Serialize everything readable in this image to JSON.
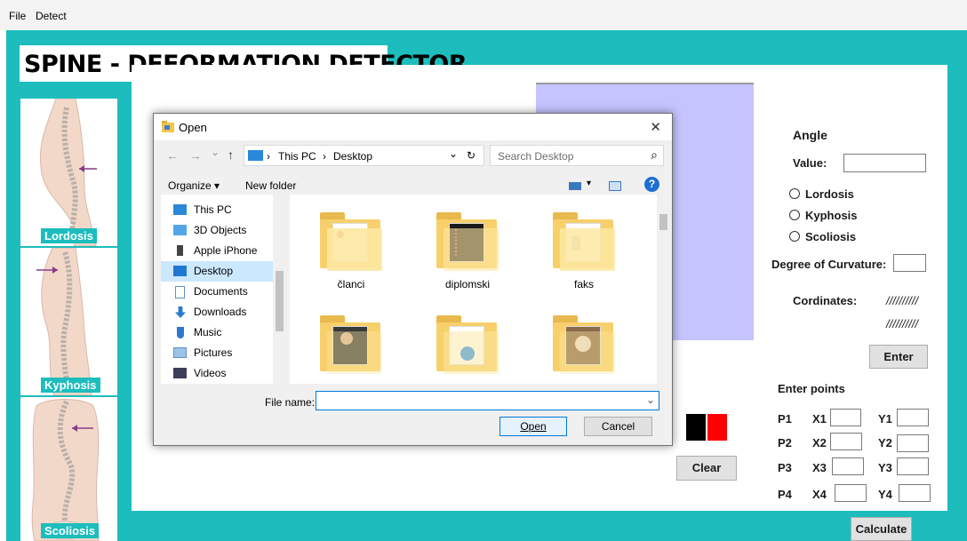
{
  "menu": {
    "file": "File",
    "detect": "Detect"
  },
  "app": {
    "title": "SPINE - DEFORMATION DETECTOR",
    "accent": "#1dbdbd",
    "spine_panels": [
      {
        "label": "Lordosis",
        "icon": "lordosis-spine-image"
      },
      {
        "label": "Kyphosis",
        "icon": "kyphosis-spine-image"
      },
      {
        "label": "Scoliosis",
        "icon": "scoliosis-spine-image"
      }
    ],
    "drawing_color": "#c5c4ff",
    "bold_label": "old",
    "color_swatches": [
      "#000000",
      "#ff0000"
    ],
    "clear_button": "Clear"
  },
  "right_panel": {
    "angle_title": "Angle",
    "value_label": "Value:",
    "value_input": "",
    "radios": [
      "Lordosis",
      "Kyphosis",
      "Scoliosis"
    ],
    "degree_label": "Degree of Curvature:",
    "degree_input": "",
    "cordinates_label": "Cordinates:",
    "cordinates_values": [
      "//////////",
      "//////////"
    ],
    "enter_button": "Enter",
    "enter_points_label": "Enter points",
    "points": [
      {
        "p": "P1",
        "x": "X1",
        "y": "Y1"
      },
      {
        "p": "P2",
        "x": "X2",
        "y": "Y2"
      },
      {
        "p": "P3",
        "x": "X3",
        "y": "Y3"
      },
      {
        "p": "P4",
        "x": "X4",
        "y": "Y4"
      }
    ],
    "calculate_button": "Calculate"
  },
  "dialog": {
    "title": "Open",
    "close": "✕",
    "back": "←",
    "forward": "→",
    "recent": "⌄",
    "up": "↑",
    "breadcrumb_sep": "›",
    "path": [
      "This PC",
      "Desktop"
    ],
    "dropdown": "⌄",
    "refresh": "↻",
    "search_placeholder": "Search Desktop",
    "search_icon": "⌕",
    "organize": "Organize ▾",
    "new_folder": "New folder",
    "view_icon": "▾",
    "help": "?",
    "nav_items": [
      {
        "label": "This PC",
        "icon": "this-pc-icon"
      },
      {
        "label": "3D Objects",
        "icon": "3d-objects-icon"
      },
      {
        "label": "Apple iPhone",
        "icon": "phone-icon"
      },
      {
        "label": "Desktop",
        "icon": "desktop-icon",
        "selected": true
      },
      {
        "label": "Documents",
        "icon": "documents-icon"
      },
      {
        "label": "Downloads",
        "icon": "downloads-icon"
      },
      {
        "label": "Music",
        "icon": "music-icon"
      },
      {
        "label": "Pictures",
        "icon": "pictures-icon"
      },
      {
        "label": "Videos",
        "icon": "videos-icon"
      }
    ],
    "files": [
      "članci",
      "diplomski",
      "faks",
      "",
      "",
      ""
    ],
    "file_name_label": "File name:",
    "file_name_value": "",
    "open_button": "Open",
    "cancel_button": "Cancel"
  }
}
